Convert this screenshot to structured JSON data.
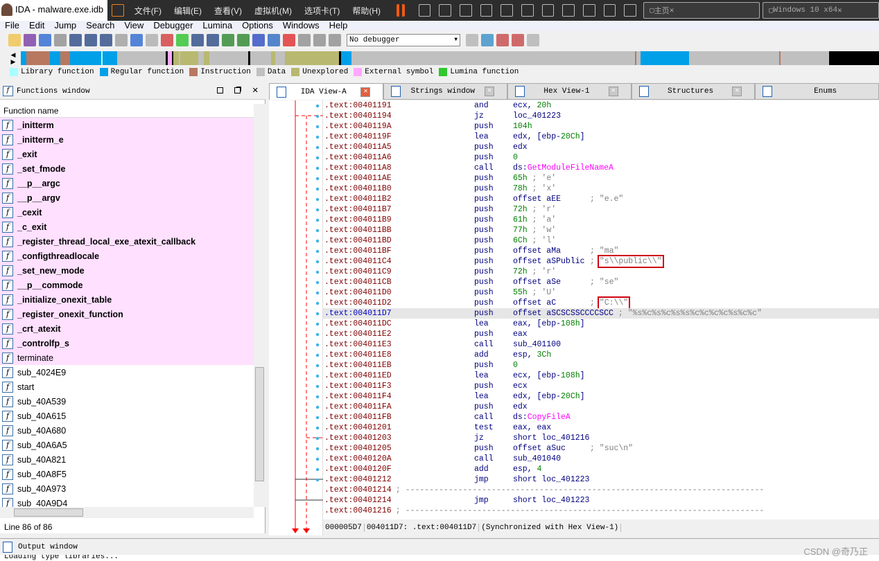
{
  "window": {
    "title": "IDA - malware.exe.idb"
  },
  "vm_menu": [
    "文件(F)",
    "编辑(E)",
    "查看(V)",
    "虚拟机(M)",
    "选项卡(T)",
    "帮助(H)"
  ],
  "vm_tabs": [
    {
      "label": "主页",
      "icon": "home-icon"
    },
    {
      "label": "Windows 10 x64",
      "icon": "vm-icon"
    }
  ],
  "menu": [
    "File",
    "Edit",
    "Jump",
    "Search",
    "View",
    "Debugger",
    "Lumina",
    "Options",
    "Windows",
    "Help"
  ],
  "toolbar": {
    "debugger_select": "No debugger"
  },
  "legend": [
    {
      "label": "Library function",
      "color": "#a8ffff"
    },
    {
      "label": "Regular function",
      "color": "#00a0e8"
    },
    {
      "label": "Instruction",
      "color": "#b87860"
    },
    {
      "label": "Data",
      "color": "#c0c0c0"
    },
    {
      "label": "Unexplored",
      "color": "#b8b870"
    },
    {
      "label": "External symbol",
      "color": "#ffa8ff"
    },
    {
      "label": "Lumina function",
      "color": "#30c830"
    }
  ],
  "functions_window": {
    "title": "Functions window",
    "column": "Function name",
    "line_status": "Line 86 of 86",
    "items": [
      {
        "name": "_initterm",
        "lib": true
      },
      {
        "name": "_initterm_e",
        "lib": true
      },
      {
        "name": "_exit",
        "lib": true
      },
      {
        "name": "_set_fmode",
        "lib": true
      },
      {
        "name": "__p__argc",
        "lib": true
      },
      {
        "name": "__p__argv",
        "lib": true
      },
      {
        "name": "_cexit",
        "lib": true
      },
      {
        "name": "_c_exit",
        "lib": true
      },
      {
        "name": "_register_thread_local_exe_atexit_callback",
        "lib": true
      },
      {
        "name": "_configthreadlocale",
        "lib": true
      },
      {
        "name": "_set_new_mode",
        "lib": true
      },
      {
        "name": "__p__commode",
        "lib": true
      },
      {
        "name": "_initialize_onexit_table",
        "lib": true
      },
      {
        "name": "_register_onexit_function",
        "lib": true
      },
      {
        "name": "_crt_atexit",
        "lib": true
      },
      {
        "name": "_controlfp_s",
        "lib": true
      },
      {
        "name": "terminate",
        "lib": true,
        "plain": true
      },
      {
        "name": "sub_4024E9"
      },
      {
        "name": "start"
      },
      {
        "name": "sub_40A539"
      },
      {
        "name": "sub_40A615"
      },
      {
        "name": "sub_40A680"
      },
      {
        "name": "sub_40A6A5"
      },
      {
        "name": "sub_40A821"
      },
      {
        "name": "sub_40A8F5"
      },
      {
        "name": "sub_40A973"
      },
      {
        "name": "sub_40A9D4"
      }
    ]
  },
  "tabs": [
    {
      "label": "IDA View-A",
      "active": true
    },
    {
      "label": "Strings window"
    },
    {
      "label": "Hex View-1"
    },
    {
      "label": "Structures"
    },
    {
      "label": "Enums"
    }
  ],
  "code": [
    {
      "a": ".text:00401191",
      "m": "and",
      "o": [
        [
          "ecx, ",
          ""
        ],
        [
          "20h",
          "num"
        ]
      ]
    },
    {
      "a": ".text:00401194",
      "m": "jz",
      "o": [
        [
          "loc_401223",
          ""
        ]
      ]
    },
    {
      "a": ".text:0040119A",
      "m": "push",
      "o": [
        [
          "104h",
          "num"
        ]
      ]
    },
    {
      "a": ".text:0040119F",
      "m": "lea",
      "o": [
        [
          "edx, [ebp-",
          ""
        ],
        [
          "20Ch",
          "num"
        ],
        [
          "]",
          ""
        ]
      ]
    },
    {
      "a": ".text:004011A5",
      "m": "push",
      "o": [
        [
          "edx",
          ""
        ]
      ]
    },
    {
      "a": ".text:004011A6",
      "m": "push",
      "o": [
        [
          "0",
          "num"
        ]
      ]
    },
    {
      "a": ".text:004011A8",
      "m": "call",
      "o": [
        [
          "ds:",
          ""
        ],
        [
          "GetModuleFileNameA",
          "api"
        ]
      ]
    },
    {
      "a": ".text:004011AE",
      "m": "push",
      "o": [
        [
          "65h",
          "num"
        ]
      ],
      "c": " ; 'e'"
    },
    {
      "a": ".text:004011B0",
      "m": "push",
      "o": [
        [
          "78h",
          "num"
        ]
      ],
      "c": " ; 'x'"
    },
    {
      "a": ".text:004011B2",
      "m": "push",
      "o": [
        [
          "offset aEE",
          ""
        ]
      ],
      "ca": "; \"e.e\""
    },
    {
      "a": ".text:004011B7",
      "m": "push",
      "o": [
        [
          "72h",
          "num"
        ]
      ],
      "c": " ; 'r'"
    },
    {
      "a": ".text:004011B9",
      "m": "push",
      "o": [
        [
          "61h",
          "num"
        ]
      ],
      "c": " ; 'a'"
    },
    {
      "a": ".text:004011BB",
      "m": "push",
      "o": [
        [
          "77h",
          "num"
        ]
      ],
      "c": " ; 'w'"
    },
    {
      "a": ".text:004011BD",
      "m": "push",
      "o": [
        [
          "6Ch",
          "num"
        ]
      ],
      "c": " ; 'l'"
    },
    {
      "a": ".text:004011BF",
      "m": "push",
      "o": [
        [
          "offset aMa",
          ""
        ]
      ],
      "ca": "; \"ma\""
    },
    {
      "a": ".text:004011C4",
      "m": "push",
      "o": [
        [
          "offset aSPublic",
          ""
        ]
      ],
      "ca": "; ",
      "cb": "\"s\\\\public\\\\\""
    },
    {
      "a": ".text:004011C9",
      "m": "push",
      "o": [
        [
          "72h",
          "num"
        ]
      ],
      "c": " ; 'r'"
    },
    {
      "a": ".text:004011CB",
      "m": "push",
      "o": [
        [
          "offset aSe",
          ""
        ]
      ],
      "ca": "; \"se\""
    },
    {
      "a": ".text:004011D0",
      "m": "push",
      "o": [
        [
          "55h",
          "num"
        ]
      ],
      "c": " ; 'U'"
    },
    {
      "a": ".text:004011D2",
      "m": "push",
      "o": [
        [
          "offset aC",
          ""
        ]
      ],
      "ca": "; ",
      "cb": "\"C:\\\\\""
    },
    {
      "a": ".text:004011D7",
      "m": "push",
      "o": [
        [
          "offset aSCSCSSCCCCSCC",
          ""
        ]
      ],
      "c": " ; \"%s%c%s%c%s%s%c%c%c%c%s%c%c\"",
      "sel": true
    },
    {
      "a": ".text:004011DC",
      "m": "lea",
      "o": [
        [
          "eax, [ebp-",
          ""
        ],
        [
          "108h",
          "num"
        ],
        [
          "]",
          ""
        ]
      ]
    },
    {
      "a": ".text:004011E2",
      "m": "push",
      "o": [
        [
          "eax",
          ""
        ]
      ]
    },
    {
      "a": ".text:004011E3",
      "m": "call",
      "o": [
        [
          "sub_401100",
          ""
        ]
      ]
    },
    {
      "a": ".text:004011E8",
      "m": "add",
      "o": [
        [
          "esp, ",
          ""
        ],
        [
          "3Ch",
          "num"
        ]
      ]
    },
    {
      "a": ".text:004011EB",
      "m": "push",
      "o": [
        [
          "0",
          "num"
        ]
      ]
    },
    {
      "a": ".text:004011ED",
      "m": "lea",
      "o": [
        [
          "ecx, [ebp-",
          ""
        ],
        [
          "108h",
          "num"
        ],
        [
          "]",
          ""
        ]
      ]
    },
    {
      "a": ".text:004011F3",
      "m": "push",
      "o": [
        [
          "ecx",
          ""
        ]
      ]
    },
    {
      "a": ".text:004011F4",
      "m": "lea",
      "o": [
        [
          "edx, [ebp-",
          ""
        ],
        [
          "20Ch",
          "num"
        ],
        [
          "]",
          ""
        ]
      ]
    },
    {
      "a": ".text:004011FA",
      "m": "push",
      "o": [
        [
          "edx",
          ""
        ]
      ]
    },
    {
      "a": ".text:004011FB",
      "m": "call",
      "o": [
        [
          "ds:",
          ""
        ],
        [
          "CopyFileA",
          "api"
        ]
      ]
    },
    {
      "a": ".text:00401201",
      "m": "test",
      "o": [
        [
          "eax, eax",
          ""
        ]
      ]
    },
    {
      "a": ".text:00401203",
      "m": "jz",
      "o": [
        [
          "short loc_401216",
          ""
        ]
      ]
    },
    {
      "a": ".text:00401205",
      "m": "push",
      "o": [
        [
          "offset aSuc",
          ""
        ]
      ],
      "ca": "; \"suc\\n\""
    },
    {
      "a": ".text:0040120A",
      "m": "call",
      "o": [
        [
          "sub_401040",
          ""
        ]
      ]
    },
    {
      "a": ".text:0040120F",
      "m": "add",
      "o": [
        [
          "esp, ",
          ""
        ],
        [
          "4",
          "num"
        ]
      ]
    },
    {
      "a": ".text:00401212",
      "m": "jmp",
      "o": [
        [
          "short loc_401223",
          ""
        ]
      ]
    },
    {
      "a": ".text:00401214",
      "sep": " ; ---------------------------------------------------------------------------"
    },
    {
      "a": ".text:00401214",
      "m": "jmp",
      "o": [
        [
          "short loc_401223",
          ""
        ]
      ]
    },
    {
      "a": ".text:00401216",
      "sep": " ; ---------------------------------------------------------------------------"
    }
  ],
  "status": [
    "000005D7",
    "004011D7: .text:004011D7",
    "(Synchronized with Hex View-1)"
  ],
  "output": {
    "title": "Output window",
    "text": "Loading type libraries..."
  },
  "watermark": "CSDN @奇乃正"
}
